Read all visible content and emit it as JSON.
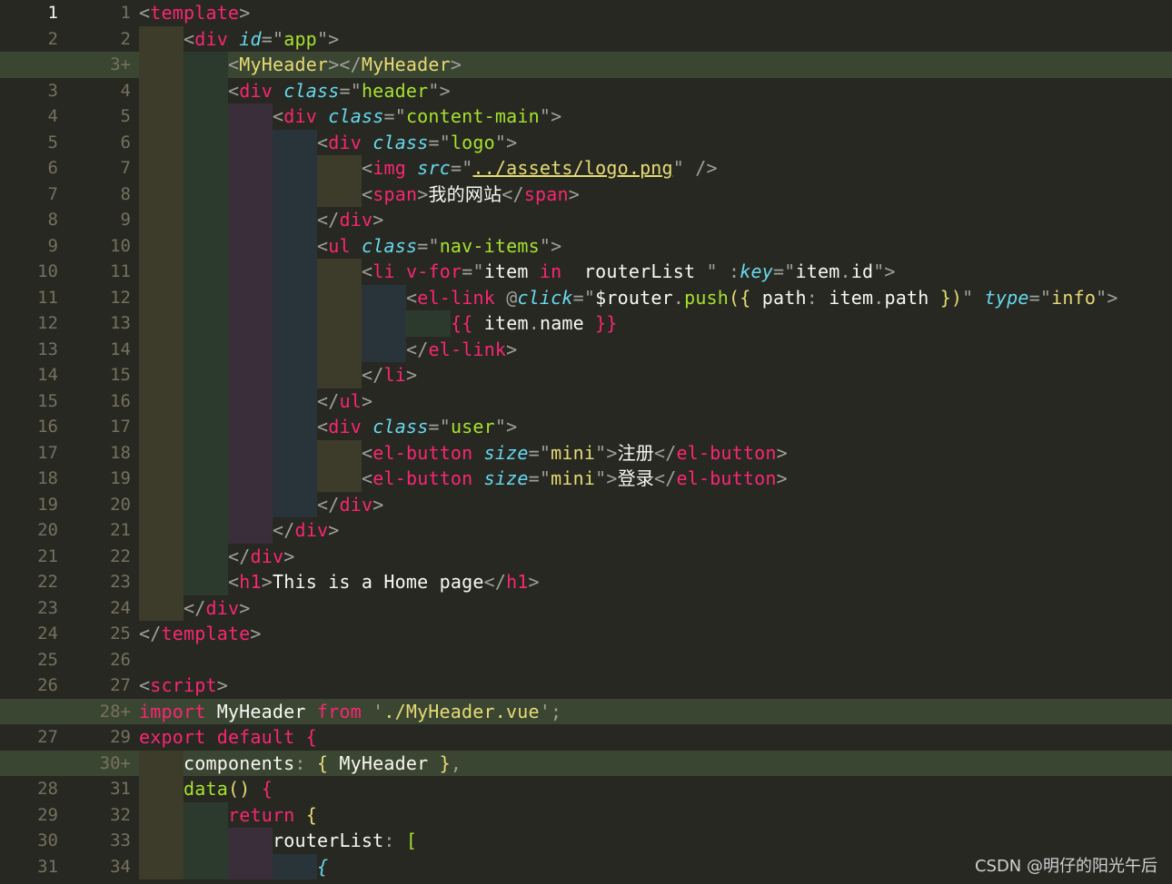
{
  "editor": {
    "lines": [
      {
        "old": "1",
        "new": "1",
        "current": true,
        "added": false,
        "indent": 0,
        "tokens": [
          [
            "punc",
            "<"
          ],
          [
            "tag",
            "template"
          ],
          [
            "punc",
            ">"
          ]
        ]
      },
      {
        "old": "2",
        "new": "2",
        "added": false,
        "indent": 1,
        "tokens": [
          [
            "punc",
            "<"
          ],
          [
            "tag",
            "div"
          ],
          [
            "text",
            " "
          ],
          [
            "attr",
            "id"
          ],
          [
            "punc",
            "=\""
          ],
          [
            "str",
            "app"
          ],
          [
            "punc",
            "\">"
          ]
        ]
      },
      {
        "old": "",
        "new": "3+",
        "added": true,
        "indent": 2,
        "tokens": [
          [
            "punc",
            "<"
          ],
          [
            "cmp",
            "MyHeader"
          ],
          [
            "punc",
            "></"
          ],
          [
            "cmp",
            "MyHeader"
          ],
          [
            "punc",
            ">"
          ]
        ]
      },
      {
        "old": "3",
        "new": "4",
        "added": false,
        "indent": 2,
        "tokens": [
          [
            "punc",
            "<"
          ],
          [
            "tag",
            "div"
          ],
          [
            "text",
            " "
          ],
          [
            "attr",
            "class"
          ],
          [
            "punc",
            "=\""
          ],
          [
            "str",
            "header"
          ],
          [
            "punc",
            "\">"
          ]
        ]
      },
      {
        "old": "4",
        "new": "5",
        "added": false,
        "indent": 3,
        "tokens": [
          [
            "punc",
            "<"
          ],
          [
            "tag",
            "div"
          ],
          [
            "text",
            " "
          ],
          [
            "attr",
            "class"
          ],
          [
            "punc",
            "=\""
          ],
          [
            "str",
            "content-main"
          ],
          [
            "punc",
            "\">"
          ]
        ]
      },
      {
        "old": "5",
        "new": "6",
        "added": false,
        "indent": 4,
        "tokens": [
          [
            "punc",
            "<"
          ],
          [
            "tag",
            "div"
          ],
          [
            "text",
            " "
          ],
          [
            "attr",
            "class"
          ],
          [
            "punc",
            "=\""
          ],
          [
            "str",
            "logo"
          ],
          [
            "punc",
            "\">"
          ]
        ]
      },
      {
        "old": "6",
        "new": "7",
        "added": false,
        "indent": 5,
        "tokens": [
          [
            "punc",
            "<"
          ],
          [
            "tag",
            "img"
          ],
          [
            "text",
            " "
          ],
          [
            "attr",
            "src"
          ],
          [
            "punc",
            "=\""
          ],
          [
            "link",
            "../assets/logo.png"
          ],
          [
            "punc",
            "\" />"
          ]
        ]
      },
      {
        "old": "7",
        "new": "8",
        "added": false,
        "indent": 5,
        "tokens": [
          [
            "punc",
            "<"
          ],
          [
            "tag",
            "span"
          ],
          [
            "punc",
            ">"
          ],
          [
            "text",
            "我的网站"
          ],
          [
            "punc",
            "</"
          ],
          [
            "tag",
            "span"
          ],
          [
            "punc",
            ">"
          ]
        ]
      },
      {
        "old": "8",
        "new": "9",
        "added": false,
        "indent": 4,
        "tokens": [
          [
            "punc",
            "</"
          ],
          [
            "tag",
            "div"
          ],
          [
            "punc",
            ">"
          ]
        ]
      },
      {
        "old": "9",
        "new": "10",
        "added": false,
        "indent": 4,
        "tokens": [
          [
            "punc",
            "<"
          ],
          [
            "tag",
            "ul"
          ],
          [
            "text",
            " "
          ],
          [
            "attr",
            "class"
          ],
          [
            "punc",
            "=\""
          ],
          [
            "str",
            "nav-items"
          ],
          [
            "punc",
            "\">"
          ]
        ]
      },
      {
        "old": "10",
        "new": "11",
        "added": false,
        "indent": 5,
        "tokens": [
          [
            "punc",
            "<"
          ],
          [
            "tag",
            "li"
          ],
          [
            "text",
            " "
          ],
          [
            "dir",
            "v-for"
          ],
          [
            "punc",
            "=\""
          ],
          [
            "text",
            "item "
          ],
          [
            "kw",
            "in"
          ],
          [
            "text",
            "  routerList "
          ],
          [
            "punc",
            "\" :"
          ],
          [
            "attr",
            "key"
          ],
          [
            "punc",
            "=\""
          ],
          [
            "text",
            "item"
          ],
          [
            "punc",
            "."
          ],
          [
            "text",
            "id"
          ],
          [
            "punc",
            "\">"
          ]
        ]
      },
      {
        "old": "11",
        "new": "12",
        "added": false,
        "indent": 6,
        "tokens": [
          [
            "punc",
            "<"
          ],
          [
            "tag",
            "el-link"
          ],
          [
            "text",
            " "
          ],
          [
            "punc",
            "@"
          ],
          [
            "attr",
            "click"
          ],
          [
            "punc",
            "=\""
          ],
          [
            "text",
            "$router"
          ],
          [
            "punc",
            "."
          ],
          [
            "fn",
            "push"
          ],
          [
            "brace",
            "({"
          ],
          [
            "text",
            " path"
          ],
          [
            "punc",
            ":"
          ],
          [
            "text",
            " item"
          ],
          [
            "punc",
            "."
          ],
          [
            "text",
            "path "
          ],
          [
            "brace",
            "})"
          ],
          [
            "punc",
            "\""
          ],
          [
            "text",
            " "
          ],
          [
            "attr",
            "type"
          ],
          [
            "punc",
            "=\""
          ],
          [
            "cmp",
            "info"
          ],
          [
            "punc",
            "\">"
          ]
        ]
      },
      {
        "old": "12",
        "new": "13",
        "added": false,
        "indent": 7,
        "tokens": [
          [
            "tag",
            "{{"
          ],
          [
            "text",
            " item"
          ],
          [
            "punc",
            "."
          ],
          [
            "text",
            "name "
          ],
          [
            "tag",
            "}}"
          ]
        ]
      },
      {
        "old": "13",
        "new": "14",
        "added": false,
        "indent": 6,
        "tokens": [
          [
            "punc",
            "</"
          ],
          [
            "tag",
            "el-link"
          ],
          [
            "punc",
            ">"
          ]
        ]
      },
      {
        "old": "14",
        "new": "15",
        "added": false,
        "indent": 5,
        "tokens": [
          [
            "punc",
            "</"
          ],
          [
            "tag",
            "li"
          ],
          [
            "punc",
            ">"
          ]
        ]
      },
      {
        "old": "15",
        "new": "16",
        "added": false,
        "indent": 4,
        "tokens": [
          [
            "punc",
            "</"
          ],
          [
            "tag",
            "ul"
          ],
          [
            "punc",
            ">"
          ]
        ]
      },
      {
        "old": "16",
        "new": "17",
        "added": false,
        "indent": 4,
        "tokens": [
          [
            "punc",
            "<"
          ],
          [
            "tag",
            "div"
          ],
          [
            "text",
            " "
          ],
          [
            "attr",
            "class"
          ],
          [
            "punc",
            "=\""
          ],
          [
            "str",
            "user"
          ],
          [
            "punc",
            "\">"
          ]
        ]
      },
      {
        "old": "17",
        "new": "18",
        "added": false,
        "indent": 5,
        "tokens": [
          [
            "punc",
            "<"
          ],
          [
            "tag",
            "el-button"
          ],
          [
            "text",
            " "
          ],
          [
            "attr",
            "size"
          ],
          [
            "punc",
            "=\""
          ],
          [
            "cmp",
            "mini"
          ],
          [
            "punc",
            "\">"
          ],
          [
            "text",
            "注册"
          ],
          [
            "punc",
            "</"
          ],
          [
            "tag",
            "el-button"
          ],
          [
            "punc",
            ">"
          ]
        ]
      },
      {
        "old": "18",
        "new": "19",
        "added": false,
        "indent": 5,
        "tokens": [
          [
            "punc",
            "<"
          ],
          [
            "tag",
            "el-button"
          ],
          [
            "text",
            " "
          ],
          [
            "attr",
            "size"
          ],
          [
            "punc",
            "=\""
          ],
          [
            "cmp",
            "mini"
          ],
          [
            "punc",
            "\">"
          ],
          [
            "text",
            "登录"
          ],
          [
            "punc",
            "</"
          ],
          [
            "tag",
            "el-button"
          ],
          [
            "punc",
            ">"
          ]
        ]
      },
      {
        "old": "19",
        "new": "20",
        "added": false,
        "indent": 4,
        "tokens": [
          [
            "punc",
            "</"
          ],
          [
            "tag",
            "div"
          ],
          [
            "punc",
            ">"
          ]
        ]
      },
      {
        "old": "20",
        "new": "21",
        "added": false,
        "indent": 3,
        "tokens": [
          [
            "punc",
            "</"
          ],
          [
            "tag",
            "div"
          ],
          [
            "punc",
            ">"
          ]
        ]
      },
      {
        "old": "21",
        "new": "22",
        "added": false,
        "indent": 2,
        "tokens": [
          [
            "punc",
            "</"
          ],
          [
            "tag",
            "div"
          ],
          [
            "punc",
            ">"
          ]
        ]
      },
      {
        "old": "22",
        "new": "23",
        "added": false,
        "indent": 2,
        "tokens": [
          [
            "punc",
            "<"
          ],
          [
            "tag",
            "h1"
          ],
          [
            "punc",
            ">"
          ],
          [
            "text",
            "This is a Home page"
          ],
          [
            "punc",
            "</"
          ],
          [
            "tag",
            "h1"
          ],
          [
            "punc",
            ">"
          ]
        ]
      },
      {
        "old": "23",
        "new": "24",
        "added": false,
        "indent": 1,
        "tokens": [
          [
            "punc",
            "</"
          ],
          [
            "tag",
            "div"
          ],
          [
            "punc",
            ">"
          ]
        ]
      },
      {
        "old": "24",
        "new": "25",
        "added": false,
        "indent": 0,
        "tokens": [
          [
            "punc",
            "</"
          ],
          [
            "tag",
            "template"
          ],
          [
            "punc",
            ">"
          ]
        ]
      },
      {
        "old": "25",
        "new": "26",
        "added": false,
        "indent": 0,
        "tokens": []
      },
      {
        "old": "26",
        "new": "27",
        "added": false,
        "indent": 0,
        "tokens": [
          [
            "punc",
            "<"
          ],
          [
            "tag",
            "script"
          ],
          [
            "punc",
            ">"
          ]
        ]
      },
      {
        "old": "",
        "new": "28+",
        "added": true,
        "indent": 0,
        "tokens": [
          [
            "kw",
            "import"
          ],
          [
            "text",
            " MyHeader "
          ],
          [
            "kw",
            "from"
          ],
          [
            "text",
            " "
          ],
          [
            "punc",
            "'"
          ],
          [
            "cmp",
            "./MyHeader.vue"
          ],
          [
            "punc",
            "';"
          ]
        ]
      },
      {
        "old": "27",
        "new": "29",
        "added": false,
        "indent": 0,
        "tokens": [
          [
            "kw",
            "export"
          ],
          [
            "text",
            " "
          ],
          [
            "kw",
            "default"
          ],
          [
            "text",
            " "
          ],
          [
            "tag",
            "{"
          ]
        ]
      },
      {
        "old": "",
        "new": "30+",
        "added": true,
        "indent": 1,
        "tokens": [
          [
            "text",
            "components"
          ],
          [
            "punc",
            ":"
          ],
          [
            "text",
            " "
          ],
          [
            "brace",
            "{"
          ],
          [
            "text",
            " MyHeader "
          ],
          [
            "brace",
            "}"
          ],
          [
            "punc",
            ","
          ]
        ]
      },
      {
        "old": "28",
        "new": "31",
        "added": false,
        "indent": 1,
        "tokens": [
          [
            "fn",
            "data"
          ],
          [
            "brace",
            "()"
          ],
          [
            "text",
            " "
          ],
          [
            "tag",
            "{"
          ]
        ]
      },
      {
        "old": "29",
        "new": "32",
        "added": false,
        "indent": 2,
        "tokens": [
          [
            "kw",
            "return"
          ],
          [
            "text",
            " "
          ],
          [
            "brace",
            "{"
          ]
        ]
      },
      {
        "old": "30",
        "new": "33",
        "added": false,
        "indent": 3,
        "tokens": [
          [
            "text",
            "routerList"
          ],
          [
            "punc",
            ":"
          ],
          [
            "text",
            " "
          ],
          [
            "str",
            "["
          ]
        ]
      },
      {
        "old": "31",
        "new": "34",
        "added": false,
        "indent": 4,
        "tokens": [
          [
            "attr",
            "{"
          ]
        ]
      }
    ]
  },
  "watermark": "CSDN @明仔的阳光午后"
}
